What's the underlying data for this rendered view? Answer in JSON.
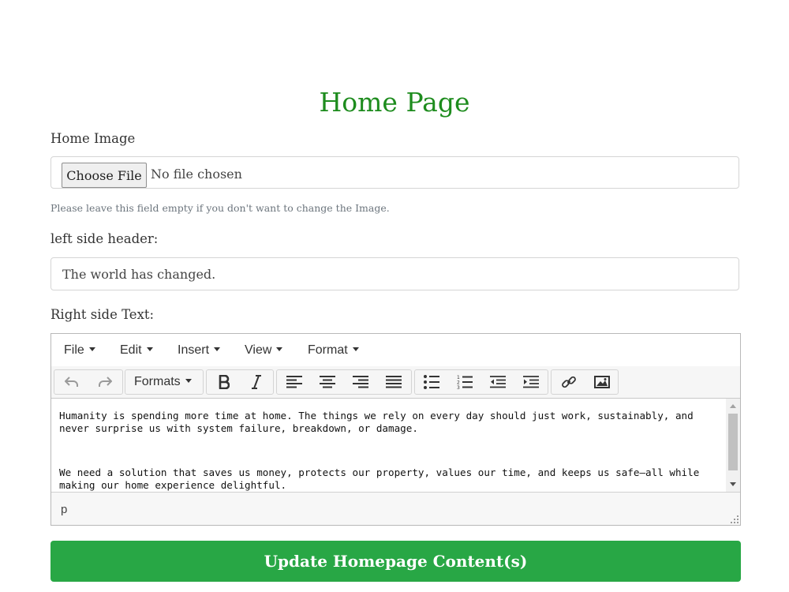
{
  "page": {
    "title": "Home Page",
    "title_color": "#1e8c1e",
    "accent_color": "#28a745"
  },
  "home_image": {
    "label": "Home Image",
    "choose_button": "Choose File",
    "status": "No file chosen",
    "help": "Please leave this field empty if you don't want to change the Image."
  },
  "left_header": {
    "label": "left side header:",
    "value": "The world has changed."
  },
  "right_text": {
    "label": "Right side Text:",
    "editor": {
      "menu": [
        "File",
        "Edit",
        "Insert",
        "View",
        "Format"
      ],
      "toolbar": {
        "formats_label": "Formats",
        "icons": [
          "undo-icon",
          "redo-icon",
          "bold-icon",
          "italic-icon",
          "align-left-icon",
          "align-center-icon",
          "align-right-icon",
          "align-justify-icon",
          "bullet-list-icon",
          "numbered-list-icon",
          "outdent-icon",
          "indent-icon",
          "link-icon",
          "image-icon"
        ]
      },
      "paragraphs": [
        "Humanity is spending more time at home. The things we rely on every day should just work, sustainably, and never surprise us with system failure, breakdown, or damage.",
        "We need a solution that saves us money, protects our property, values our time, and keeps us safe—all while making our home experience delightful."
      ],
      "status_path": "p"
    }
  },
  "submit": {
    "label": "Update Homepage Content(s)"
  }
}
